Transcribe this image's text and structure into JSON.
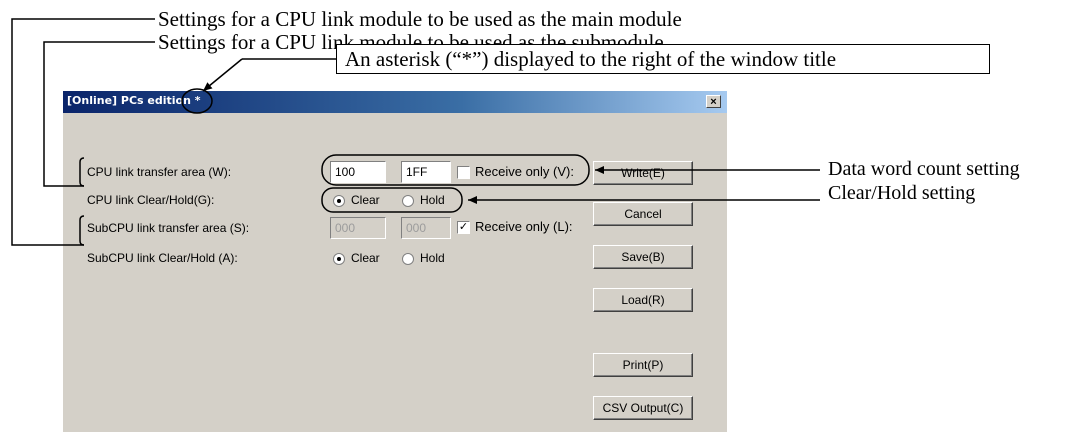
{
  "annotations": {
    "main_module": "Settings for a CPU link module to be used as the main module",
    "submodule": "Settings for a CPU link module to be used as the submodule",
    "asterisk": "An asterisk (“*”) displayed to the right of the window title",
    "data_word_count": "Data word count setting",
    "clear_hold": "Clear/Hold setting"
  },
  "window": {
    "title": "[Online] PCs edition *",
    "close_label": "×"
  },
  "form": {
    "cpu_transfer_label": "CPU link transfer area (W):",
    "cpu_transfer_from": "100",
    "cpu_transfer_to": "1FF",
    "cpu_receive_only": "Receive only (V):",
    "cpu_receive_only_checked": false,
    "cpu_clearhold_label": "CPU link Clear/Hold(G):",
    "cpu_clear": "Clear",
    "cpu_hold": "Hold",
    "cpu_selected": "Clear",
    "sub_transfer_label": "SubCPU link transfer area (S):",
    "sub_transfer_from": "000",
    "sub_transfer_to": "000",
    "sub_receive_only": "Receive only (L):",
    "sub_receive_only_checked": true,
    "sub_clearhold_label": "SubCPU link Clear/Hold (A):",
    "sub_clear": "Clear",
    "sub_hold": "Hold",
    "sub_selected": "Clear"
  },
  "buttons": {
    "write": "Write(E)",
    "cancel": "Cancel",
    "save": "Save(B)",
    "load": "Load(R)",
    "print": "Print(P)",
    "csv_output": "CSV Output(C)"
  }
}
